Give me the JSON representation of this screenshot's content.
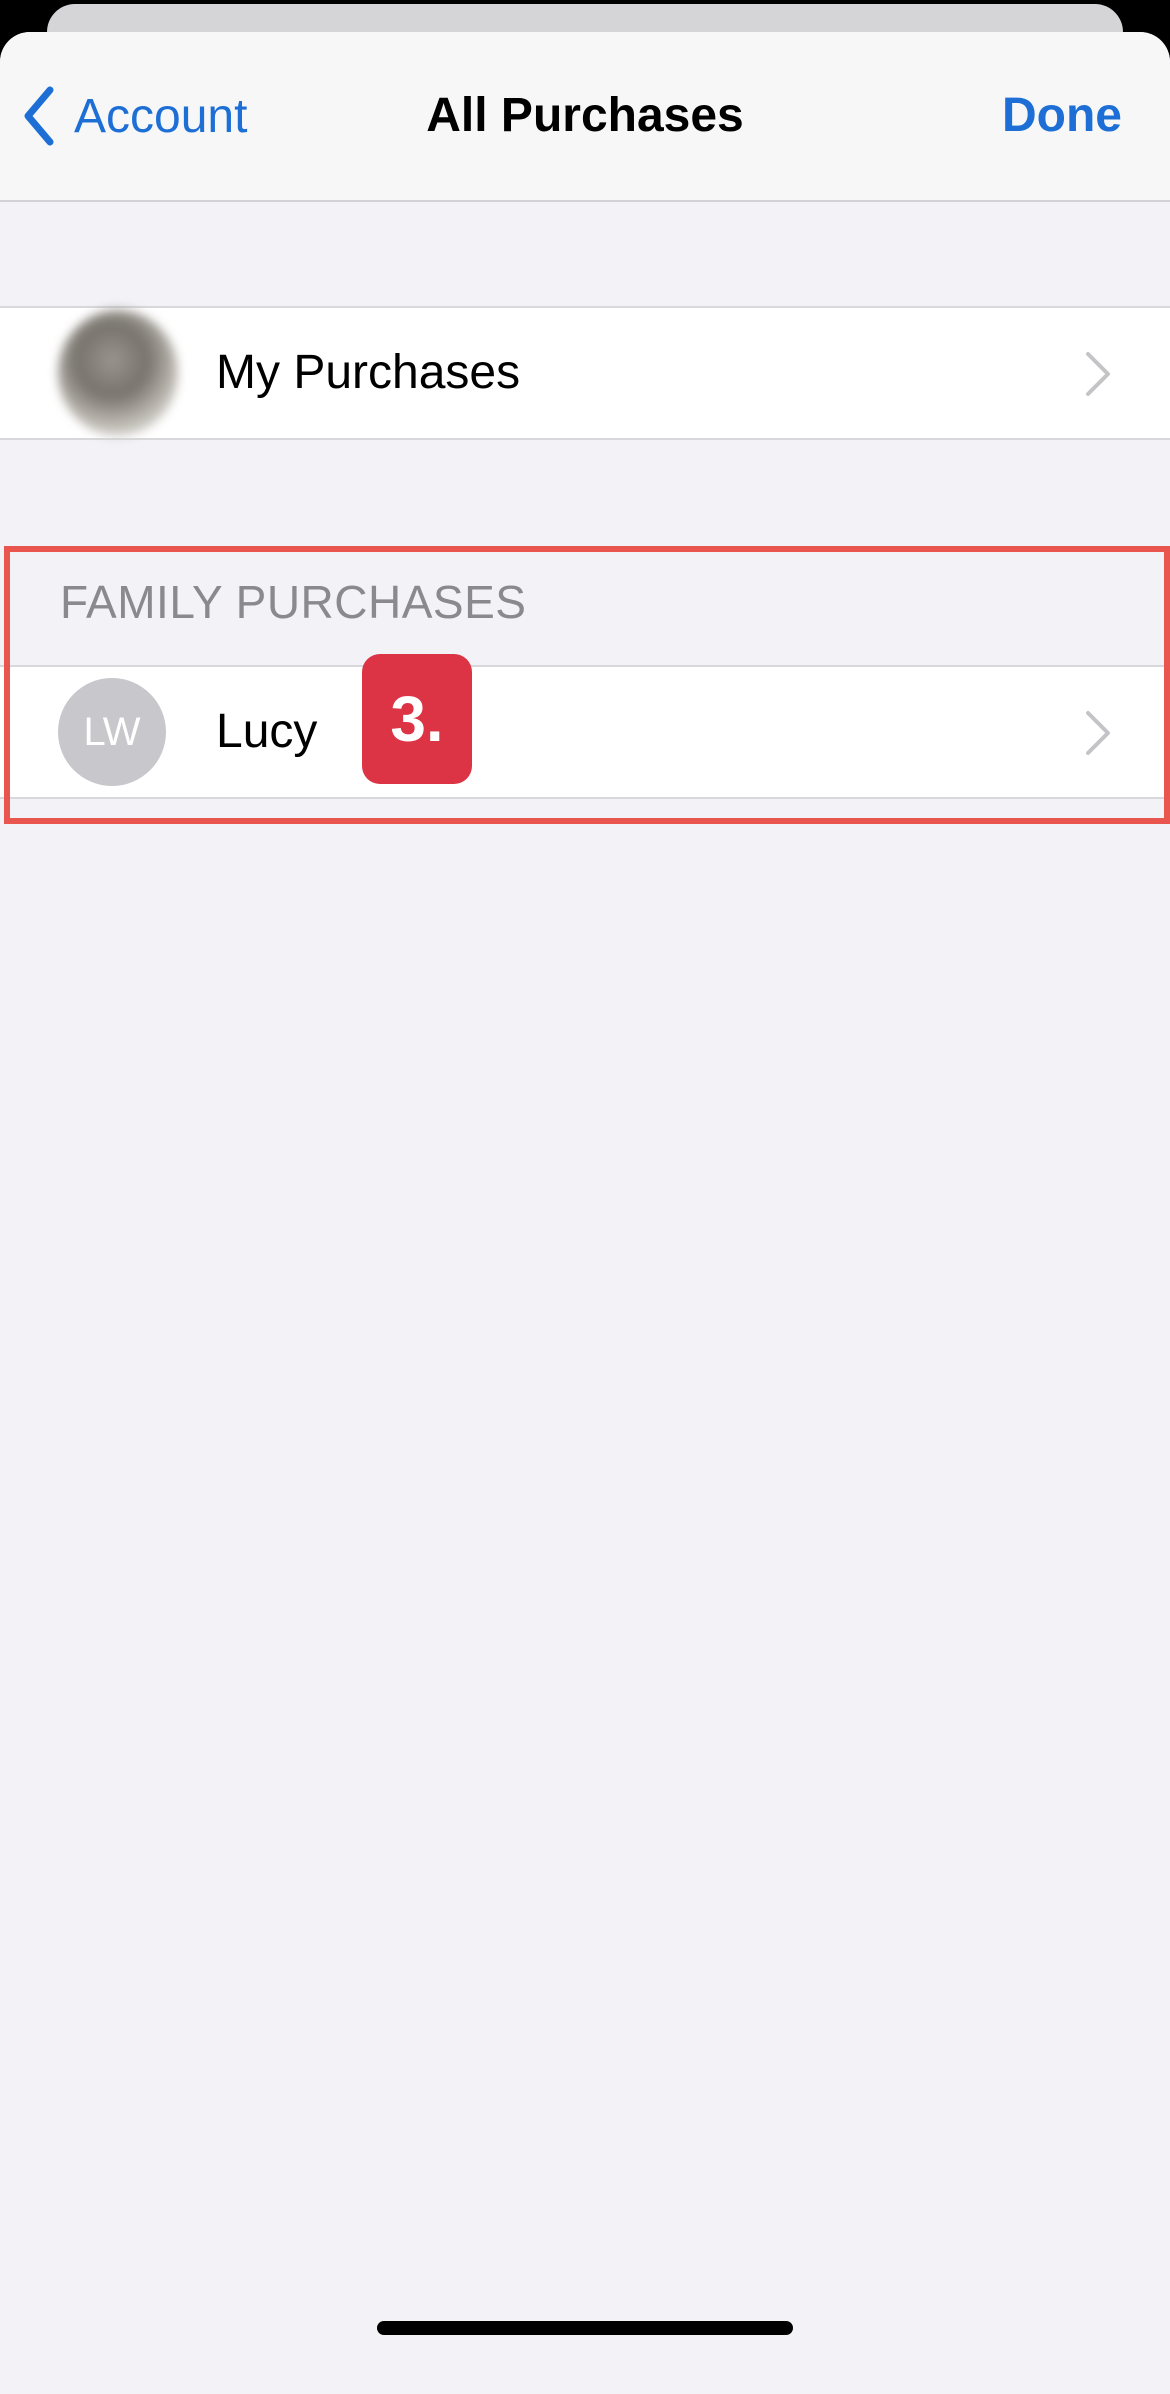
{
  "navbar": {
    "back_label": "Account",
    "title": "All Purchases",
    "done_label": "Done"
  },
  "my_purchases": {
    "label": "My Purchases"
  },
  "family_section": {
    "header": "FAMILY PURCHASES",
    "members": [
      {
        "initials": "LW",
        "name": "Lucy"
      }
    ]
  },
  "annotation": {
    "step_label": "3.",
    "highlight_color": "#e9554f",
    "badge_color": "#dc3345"
  },
  "colors": {
    "accent": "#1d6fd6",
    "background": "#f2f2f7"
  },
  "icons": {
    "back": "chevron-left-icon",
    "row_disclosure": "chevron-right-icon"
  }
}
